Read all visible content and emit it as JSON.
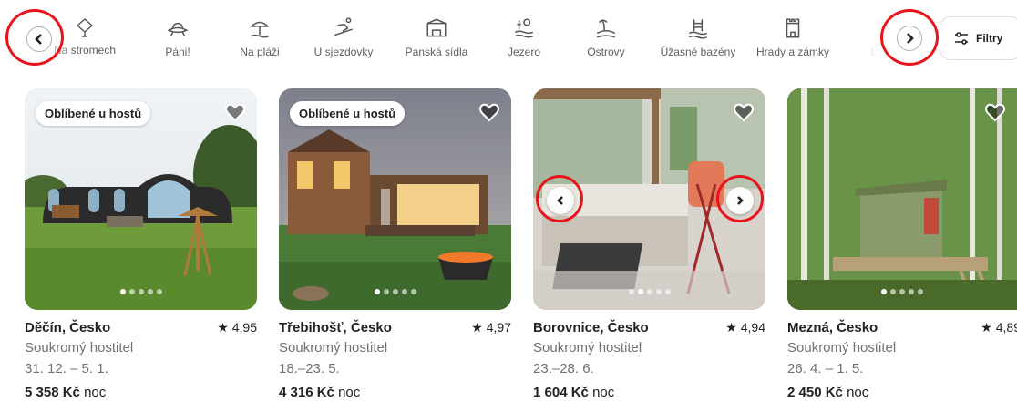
{
  "categories": [
    {
      "label": "Na stromech",
      "icon": "treehouse-icon"
    },
    {
      "label": "Páni!",
      "icon": "ufo-icon"
    },
    {
      "label": "Na pláži",
      "icon": "beach-umbrella-icon"
    },
    {
      "label": "U sjezdovky",
      "icon": "skier-icon"
    },
    {
      "label": "Panská sídla",
      "icon": "mansion-icon"
    },
    {
      "label": "Jezero",
      "icon": "lake-icon"
    },
    {
      "label": "Ostrovy",
      "icon": "island-icon"
    },
    {
      "label": "Úžasné bazény",
      "icon": "pool-icon"
    },
    {
      "label": "Hrady a zámky",
      "icon": "castle-icon"
    },
    {
      "label": "Do",
      "icon": "partial-icon"
    }
  ],
  "filter": {
    "label": "Filtry",
    "icon": "filters-icon"
  },
  "listings": [
    {
      "badge": "Oblíbené u hostů",
      "location": "Děčín, Česko",
      "rating": "★ 4,95",
      "type": "Soukromý hostitel",
      "dates": "31. 12. – 5. 1.",
      "price": "5 358 Kč",
      "price_unit": "noc"
    },
    {
      "badge": "Oblíbené u hostů",
      "location": "Třebihošť, Česko",
      "rating": "★ 4,97",
      "type": "Soukromý hostitel",
      "dates": "18.–23. 5.",
      "price": "4 316 Kč",
      "price_unit": "noc"
    },
    {
      "badge": "",
      "location": "Borovnice, Česko",
      "rating": "★ 4,94",
      "type": "Soukromý hostitel",
      "dates": "23.–28. 6.",
      "price": "1 604 Kč",
      "price_unit": "noc"
    },
    {
      "badge": "",
      "location": "Mezná, Česko",
      "rating": "★ 4,89",
      "type": "Soukromý hostitel",
      "dates": "26. 4. – 1. 5.",
      "price": "2 450 Kč",
      "price_unit": "noc"
    }
  ],
  "colors": {
    "highlight_ring": "#e8141b",
    "text": "#222222",
    "muted": "#717171"
  }
}
